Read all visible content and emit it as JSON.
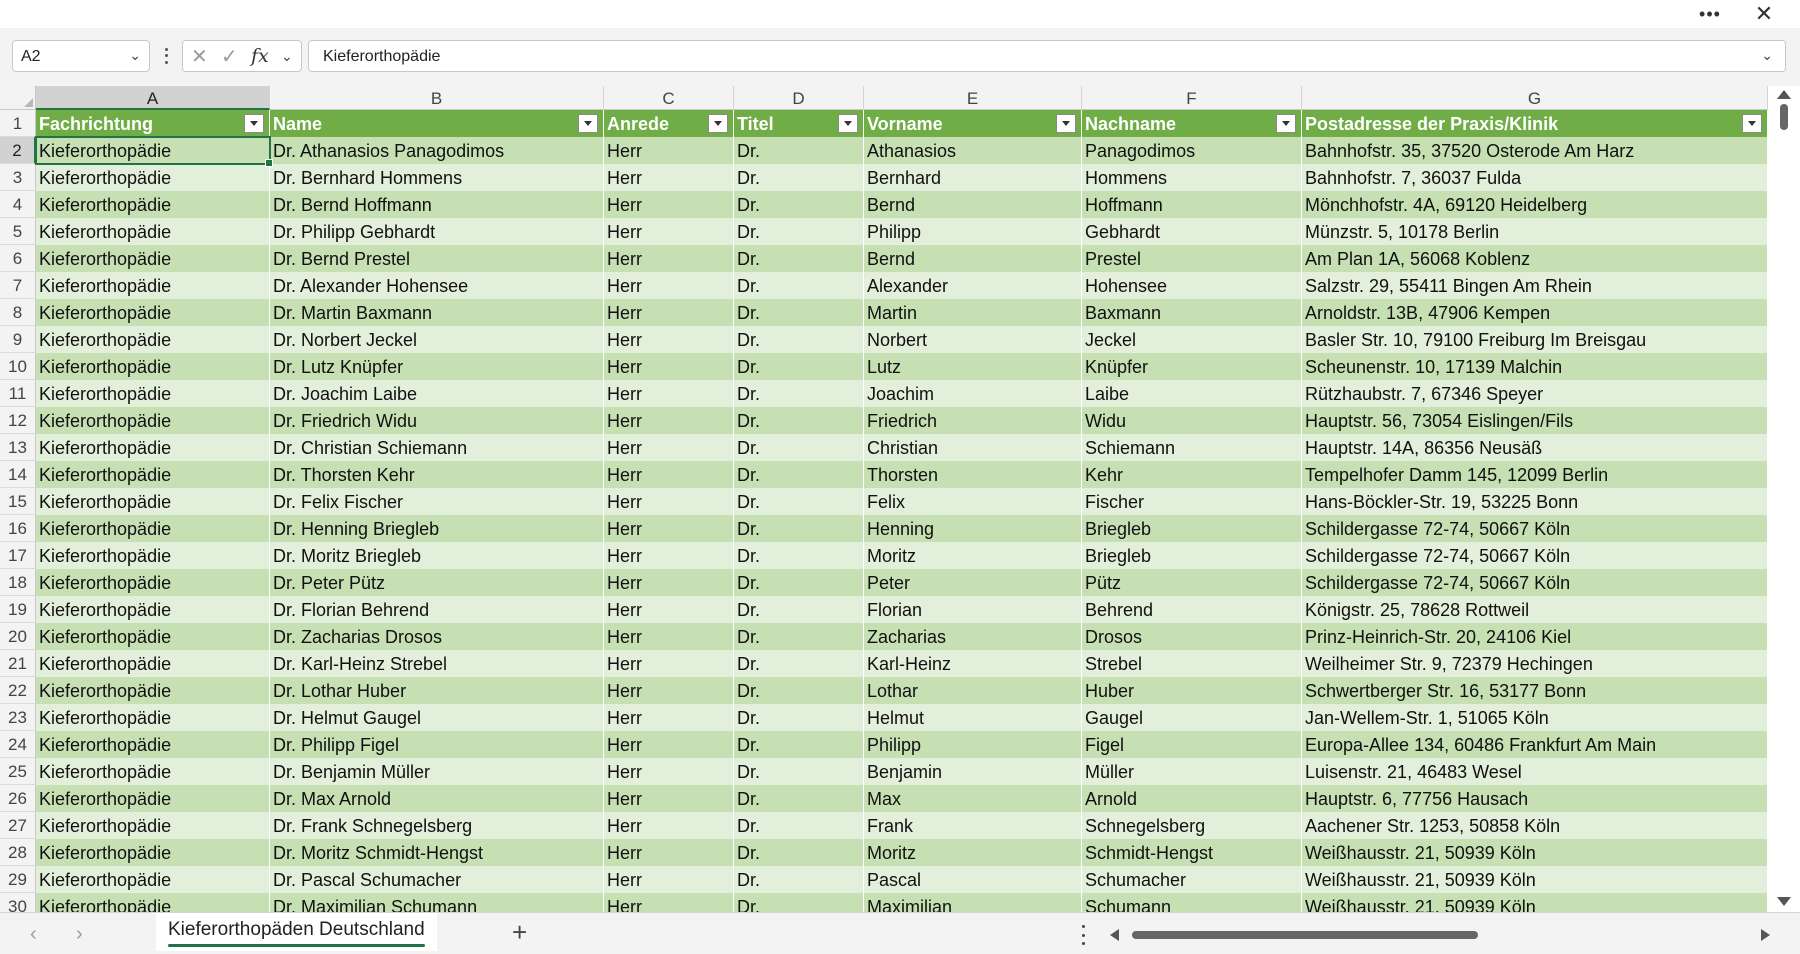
{
  "window": {
    "more_label": "•••",
    "close_label": "✕"
  },
  "formula_bar": {
    "name_box": "A2",
    "cancel_icon": "✕",
    "enter_icon": "✓",
    "fx_label": "fx",
    "value": "Kieferorthopädie"
  },
  "columns": [
    "A",
    "B",
    "C",
    "D",
    "E",
    "F",
    "G"
  ],
  "header_row_number": "1",
  "header": [
    "Fachrichtung",
    "Name",
    "Anrede",
    "Titel",
    "Vorname",
    "Nachname",
    "Postadresse der Praxis/Klinik"
  ],
  "rows": [
    {
      "n": "2",
      "cells": [
        "Kieferorthopädie",
        "Dr. Athanasios Panagodimos",
        "Herr",
        "Dr.",
        "Athanasios",
        "Panagodimos",
        "Bahnhofstr. 35, 37520 Osterode Am Harz"
      ]
    },
    {
      "n": "3",
      "cells": [
        "Kieferorthopädie",
        "Dr. Bernhard Hommens",
        "Herr",
        "Dr.",
        "Bernhard",
        "Hommens",
        "Bahnhofstr. 7, 36037 Fulda"
      ]
    },
    {
      "n": "4",
      "cells": [
        "Kieferorthopädie",
        "Dr. Bernd Hoffmann",
        "Herr",
        "Dr.",
        "Bernd",
        "Hoffmann",
        "Mönchhofstr. 4A, 69120 Heidelberg"
      ]
    },
    {
      "n": "5",
      "cells": [
        "Kieferorthopädie",
        "Dr. Philipp Gebhardt",
        "Herr",
        "Dr.",
        "Philipp",
        "Gebhardt",
        "Münzstr. 5, 10178 Berlin"
      ]
    },
    {
      "n": "6",
      "cells": [
        "Kieferorthopädie",
        "Dr. Bernd Prestel",
        "Herr",
        "Dr.",
        "Bernd",
        "Prestel",
        "Am Plan 1A, 56068 Koblenz"
      ]
    },
    {
      "n": "7",
      "cells": [
        "Kieferorthopädie",
        "Dr. Alexander Hohensee",
        "Herr",
        "Dr.",
        "Alexander",
        "Hohensee",
        "Salzstr. 29, 55411 Bingen Am Rhein"
      ]
    },
    {
      "n": "8",
      "cells": [
        "Kieferorthopädie",
        "Dr. Martin Baxmann",
        "Herr",
        "Dr.",
        "Martin",
        "Baxmann",
        "Arnoldstr. 13B, 47906 Kempen"
      ]
    },
    {
      "n": "9",
      "cells": [
        "Kieferorthopädie",
        "Dr. Norbert Jeckel",
        "Herr",
        "Dr.",
        "Norbert",
        "Jeckel",
        "Basler Str. 10, 79100 Freiburg Im Breisgau"
      ]
    },
    {
      "n": "10",
      "cells": [
        "Kieferorthopädie",
        "Dr. Lutz Knüpfer",
        "Herr",
        "Dr.",
        "Lutz",
        "Knüpfer",
        "Scheunenstr. 10, 17139 Malchin"
      ]
    },
    {
      "n": "11",
      "cells": [
        "Kieferorthopädie",
        "Dr. Joachim Laibe",
        "Herr",
        "Dr.",
        "Joachim",
        "Laibe",
        "Rützhaubstr. 7, 67346 Speyer"
      ]
    },
    {
      "n": "12",
      "cells": [
        "Kieferorthopädie",
        "Dr. Friedrich Widu",
        "Herr",
        "Dr.",
        "Friedrich",
        "Widu",
        "Hauptstr. 56, 73054 Eislingen/Fils"
      ]
    },
    {
      "n": "13",
      "cells": [
        "Kieferorthopädie",
        "Dr. Christian Schiemann",
        "Herr",
        "Dr.",
        "Christian",
        "Schiemann",
        "Hauptstr. 14A, 86356 Neusäß"
      ]
    },
    {
      "n": "14",
      "cells": [
        "Kieferorthopädie",
        "Dr. Thorsten Kehr",
        "Herr",
        "Dr.",
        "Thorsten",
        "Kehr",
        "Tempelhofer Damm 145, 12099 Berlin"
      ]
    },
    {
      "n": "15",
      "cells": [
        "Kieferorthopädie",
        "Dr. Felix Fischer",
        "Herr",
        "Dr.",
        "Felix",
        "Fischer",
        "Hans-Böckler-Str. 19, 53225 Bonn"
      ]
    },
    {
      "n": "16",
      "cells": [
        "Kieferorthopädie",
        "Dr. Henning Briegleb",
        "Herr",
        "Dr.",
        "Henning",
        "Briegleb",
        "Schildergasse 72-74, 50667 Köln"
      ]
    },
    {
      "n": "17",
      "cells": [
        "Kieferorthopädie",
        "Dr. Moritz Briegleb",
        "Herr",
        "Dr.",
        "Moritz",
        "Briegleb",
        "Schildergasse 72-74, 50667 Köln"
      ]
    },
    {
      "n": "18",
      "cells": [
        "Kieferorthopädie",
        "Dr. Peter Pütz",
        "Herr",
        "Dr.",
        "Peter",
        "Pütz",
        "Schildergasse 72-74, 50667 Köln"
      ]
    },
    {
      "n": "19",
      "cells": [
        "Kieferorthopädie",
        "Dr. Florian Behrend",
        "Herr",
        "Dr.",
        "Florian",
        "Behrend",
        "Königstr. 25, 78628 Rottweil"
      ]
    },
    {
      "n": "20",
      "cells": [
        "Kieferorthopädie",
        "Dr. Zacharias Drosos",
        "Herr",
        "Dr.",
        "Zacharias",
        "Drosos",
        "Prinz-Heinrich-Str. 20, 24106 Kiel"
      ]
    },
    {
      "n": "21",
      "cells": [
        "Kieferorthopädie",
        "Dr. Karl-Heinz Strebel",
        "Herr",
        "Dr.",
        "Karl-Heinz",
        "Strebel",
        "Weilheimer Str. 9, 72379 Hechingen"
      ]
    },
    {
      "n": "22",
      "cells": [
        "Kieferorthopädie",
        "Dr. Lothar Huber",
        "Herr",
        "Dr.",
        "Lothar",
        "Huber",
        "Schwertberger Str. 16, 53177 Bonn"
      ]
    },
    {
      "n": "23",
      "cells": [
        "Kieferorthopädie",
        "Dr. Helmut Gaugel",
        "Herr",
        "Dr.",
        "Helmut",
        "Gaugel",
        "Jan-Wellem-Str. 1, 51065 Köln"
      ]
    },
    {
      "n": "24",
      "cells": [
        "Kieferorthopädie",
        "Dr. Philipp Figel",
        "Herr",
        "Dr.",
        "Philipp",
        "Figel",
        "Europa-Allee 134, 60486 Frankfurt Am Main"
      ]
    },
    {
      "n": "25",
      "cells": [
        "Kieferorthopädie",
        "Dr. Benjamin Müller",
        "Herr",
        "Dr.",
        "Benjamin",
        "Müller",
        "Luisenstr. 21, 46483 Wesel"
      ]
    },
    {
      "n": "26",
      "cells": [
        "Kieferorthopädie",
        "Dr. Max Arnold",
        "Herr",
        "Dr.",
        "Max",
        "Arnold",
        "Hauptstr. 6, 77756 Hausach"
      ]
    },
    {
      "n": "27",
      "cells": [
        "Kieferorthopädie",
        "Dr. Frank Schnegelsberg",
        "Herr",
        "Dr.",
        "Frank",
        "Schnegelsberg",
        "Aachener Str. 1253, 50858 Köln"
      ]
    },
    {
      "n": "28",
      "cells": [
        "Kieferorthopädie",
        "Dr. Moritz Schmidt-Hengst",
        "Herr",
        "Dr.",
        "Moritz",
        "Schmidt-Hengst",
        "Weißhausstr. 21, 50939 Köln"
      ]
    },
    {
      "n": "29",
      "cells": [
        "Kieferorthopädie",
        "Dr. Pascal Schumacher",
        "Herr",
        "Dr.",
        "Pascal",
        "Schumacher",
        "Weißhausstr. 21, 50939 Köln"
      ]
    },
    {
      "n": "30",
      "cells": [
        "Kieferorthopädie",
        "Dr. Maximilian Schumann",
        "Herr",
        "Dr.",
        "Maximilian",
        "Schumann",
        "Weißhausstr. 21, 50939 Köln"
      ]
    }
  ],
  "sheet_tabs": [
    {
      "label": "Kieferorthopäden Deutschland",
      "active": true
    }
  ],
  "add_sheet_label": "+",
  "colors": {
    "table_header": "#70ad47",
    "band_dark": "#c6e0b4",
    "band_light": "#e2efda",
    "accent": "#217346"
  },
  "icons": {
    "name_box_dropdown": "chevron-down-icon",
    "cancel": "close-icon",
    "enter": "check-icon",
    "insert_function": "fx-icon",
    "filter": "filter-dropdown-icon",
    "sheet_prev": "chevron-left-icon",
    "sheet_next": "chevron-right-icon"
  }
}
